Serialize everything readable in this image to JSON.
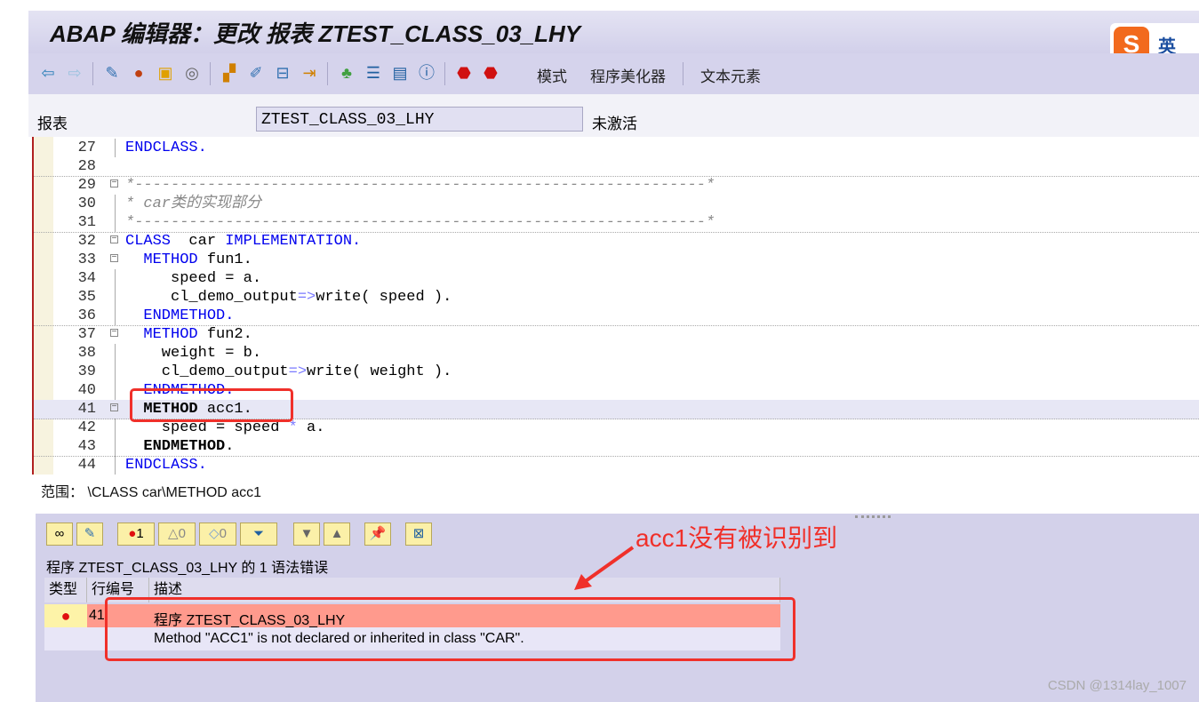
{
  "window": {
    "title": "ABAP 编辑器：更改 报表 ZTEST_CLASS_03_LHY"
  },
  "ime": {
    "label": "英"
  },
  "toolbar": {
    "mode_label": "模式",
    "pretty_printer_label": "程序美化器",
    "text_elements_label": "文本元素"
  },
  "header": {
    "label": "报表",
    "program": "ZTEST_CLASS_03_LHY",
    "status": "未激活"
  },
  "code_lines": [
    {
      "n": "27",
      "segs": [
        [
          "kw",
          "ENDCLASS."
        ]
      ]
    },
    {
      "n": "28",
      "segs": []
    },
    {
      "n": "29",
      "segs": [
        [
          "cm",
          "*---------------------------------------------------------------*"
        ]
      ]
    },
    {
      "n": "30",
      "segs": [
        [
          "cm",
          "* car类的实现部分"
        ]
      ]
    },
    {
      "n": "31",
      "segs": [
        [
          "cm",
          "*---------------------------------------------------------------*"
        ]
      ]
    },
    {
      "n": "32",
      "segs": [
        [
          "kw",
          "CLASS"
        ],
        [
          "",
          "  car "
        ],
        [
          "kw",
          "IMPLEMENTATION."
        ]
      ]
    },
    {
      "n": "33",
      "segs": [
        [
          "",
          "  "
        ],
        [
          "kw",
          "METHOD"
        ],
        [
          "",
          " fun1."
        ]
      ]
    },
    {
      "n": "34",
      "segs": [
        [
          "",
          "     speed = a."
        ]
      ]
    },
    {
      "n": "35",
      "segs": [
        [
          "",
          "     cl_demo_output"
        ],
        [
          "op",
          "=>"
        ],
        [
          "",
          "write( speed )."
        ]
      ]
    },
    {
      "n": "36",
      "segs": [
        [
          "",
          "  "
        ],
        [
          "kw",
          "ENDMETHOD."
        ]
      ]
    },
    {
      "n": "37",
      "segs": [
        [
          "",
          "  "
        ],
        [
          "kw",
          "METHOD"
        ],
        [
          "",
          " fun2."
        ]
      ]
    },
    {
      "n": "38",
      "segs": [
        [
          "",
          "    weight = b."
        ]
      ]
    },
    {
      "n": "39",
      "segs": [
        [
          "",
          "    cl_demo_output"
        ],
        [
          "op",
          "=>"
        ],
        [
          "",
          "write( weight )."
        ]
      ]
    },
    {
      "n": "40",
      "segs": [
        [
          "",
          "  "
        ],
        [
          "kw",
          "ENDMETHOD."
        ]
      ]
    },
    {
      "n": "41",
      "segs": [
        [
          "",
          "  "
        ],
        [
          "bk",
          "METHOD"
        ],
        [
          "",
          " acc1."
        ]
      ]
    },
    {
      "n": "42",
      "segs": [
        [
          "",
          "    speed = speed "
        ],
        [
          "op",
          "*"
        ],
        [
          "",
          " a."
        ]
      ]
    },
    {
      "n": "43",
      "segs": [
        [
          "",
          "  "
        ],
        [
          "bk",
          "ENDMETHOD"
        ],
        [
          "",
          "."
        ]
      ]
    },
    {
      "n": "44",
      "segs": [
        [
          "kw",
          "ENDCLASS."
        ]
      ]
    }
  ],
  "scope": {
    "label": "范围：",
    "value": "\\CLASS car\\METHOD acc1"
  },
  "errors": {
    "error_count": "1",
    "warning_count": "0",
    "info_count": "0",
    "summary": "程序 ZTEST_CLASS_03_LHY 的 1 语法错误",
    "columns": [
      "类型",
      "行编号",
      "描述"
    ],
    "rows": [
      {
        "line": "41",
        "program": "程序 ZTEST_CLASS_03_LHY",
        "message": "Method \"ACC1\" is not declared or inherited in class \"CAR\"."
      }
    ]
  },
  "annotation": {
    "text": "acc1没有被识别到",
    "color": "#f0302a"
  },
  "watermark": "CSDN @1314lay_1007"
}
